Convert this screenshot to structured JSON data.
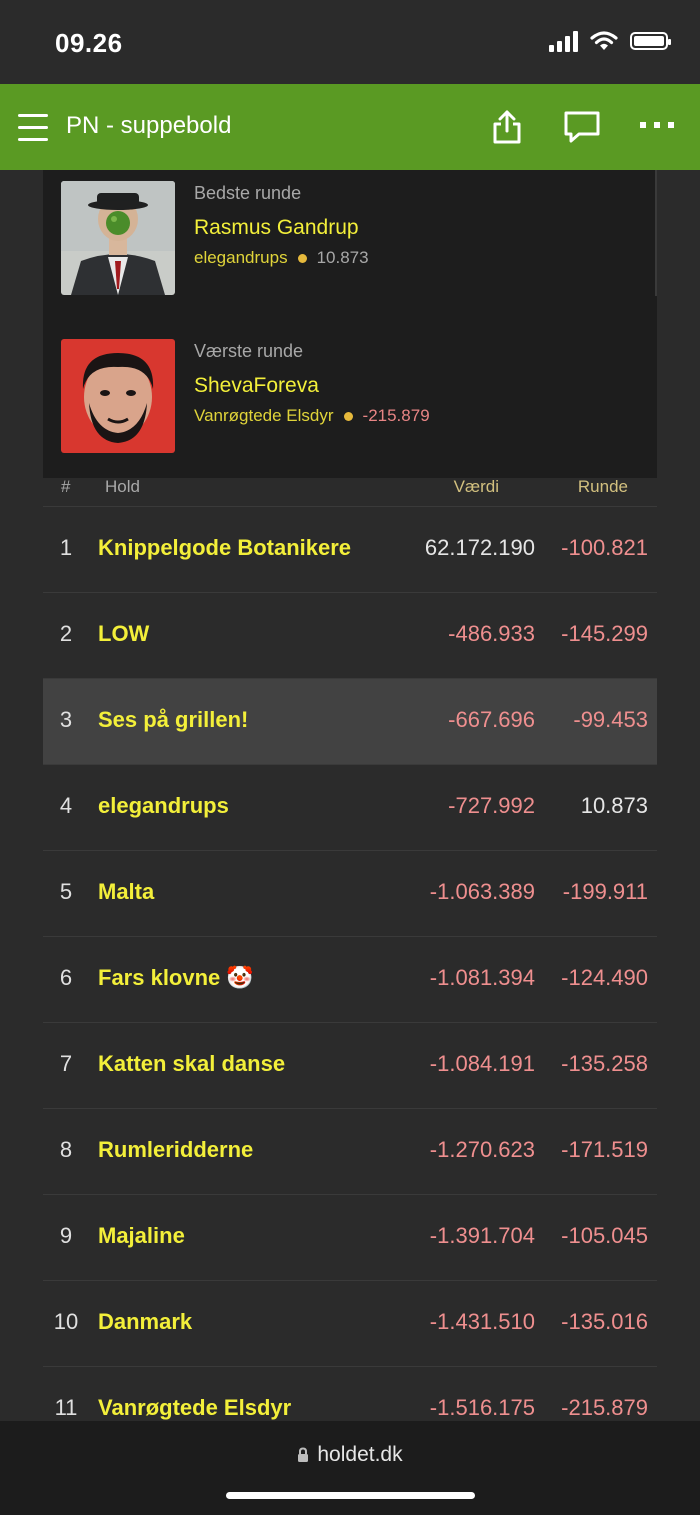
{
  "status": {
    "time": "09.26"
  },
  "header": {
    "title": "PN - suppebold"
  },
  "best_round": {
    "label": "Bedste runde",
    "name": "Rasmus Gandrup",
    "team": "elegandrups",
    "points": "10.873"
  },
  "worst_round": {
    "label": "Værste runde",
    "name": "ShevaForeva",
    "team": "Vanrøgtede Elsdyr",
    "points": "-215.879"
  },
  "table": {
    "columns": {
      "rank": "#",
      "team": "Hold",
      "value": "Værdi",
      "round": "Runde"
    },
    "rows": [
      {
        "rank": "1",
        "team": "Knippelgode Botanikere",
        "value": "62.172.190",
        "round": "-100.821"
      },
      {
        "rank": "2",
        "team": "LOW",
        "value": "-486.933",
        "round": "-145.299"
      },
      {
        "rank": "3",
        "team": "Ses på grillen!",
        "value": "-667.696",
        "round": "-99.453"
      },
      {
        "rank": "4",
        "team": "elegandrups",
        "value": "-727.992",
        "round": "10.873"
      },
      {
        "rank": "5",
        "team": "Malta",
        "value": "-1.063.389",
        "round": "-199.911"
      },
      {
        "rank": "6",
        "team": "Fars klovne 🤡",
        "value": "-1.081.394",
        "round": "-124.490"
      },
      {
        "rank": "7",
        "team": "Katten skal danse",
        "value": "-1.084.191",
        "round": "-135.258"
      },
      {
        "rank": "8",
        "team": "Rumleridderne",
        "value": "-1.270.623",
        "round": "-171.519"
      },
      {
        "rank": "9",
        "team": "Majaline",
        "value": "-1.391.704",
        "round": "-105.045"
      },
      {
        "rank": "10",
        "team": "Danmark",
        "value": "-1.431.510",
        "round": "-135.016"
      },
      {
        "rank": "11",
        "team": "Vanrøgtede Elsdyr",
        "value": "-1.516.175",
        "round": "-215.879"
      }
    ]
  },
  "browser": {
    "url": "holdet.dk"
  },
  "colors": {
    "brand_green": "#5a9a23",
    "team_yellow": "#f3ef3a",
    "negative_red": "#ef8f8f"
  }
}
